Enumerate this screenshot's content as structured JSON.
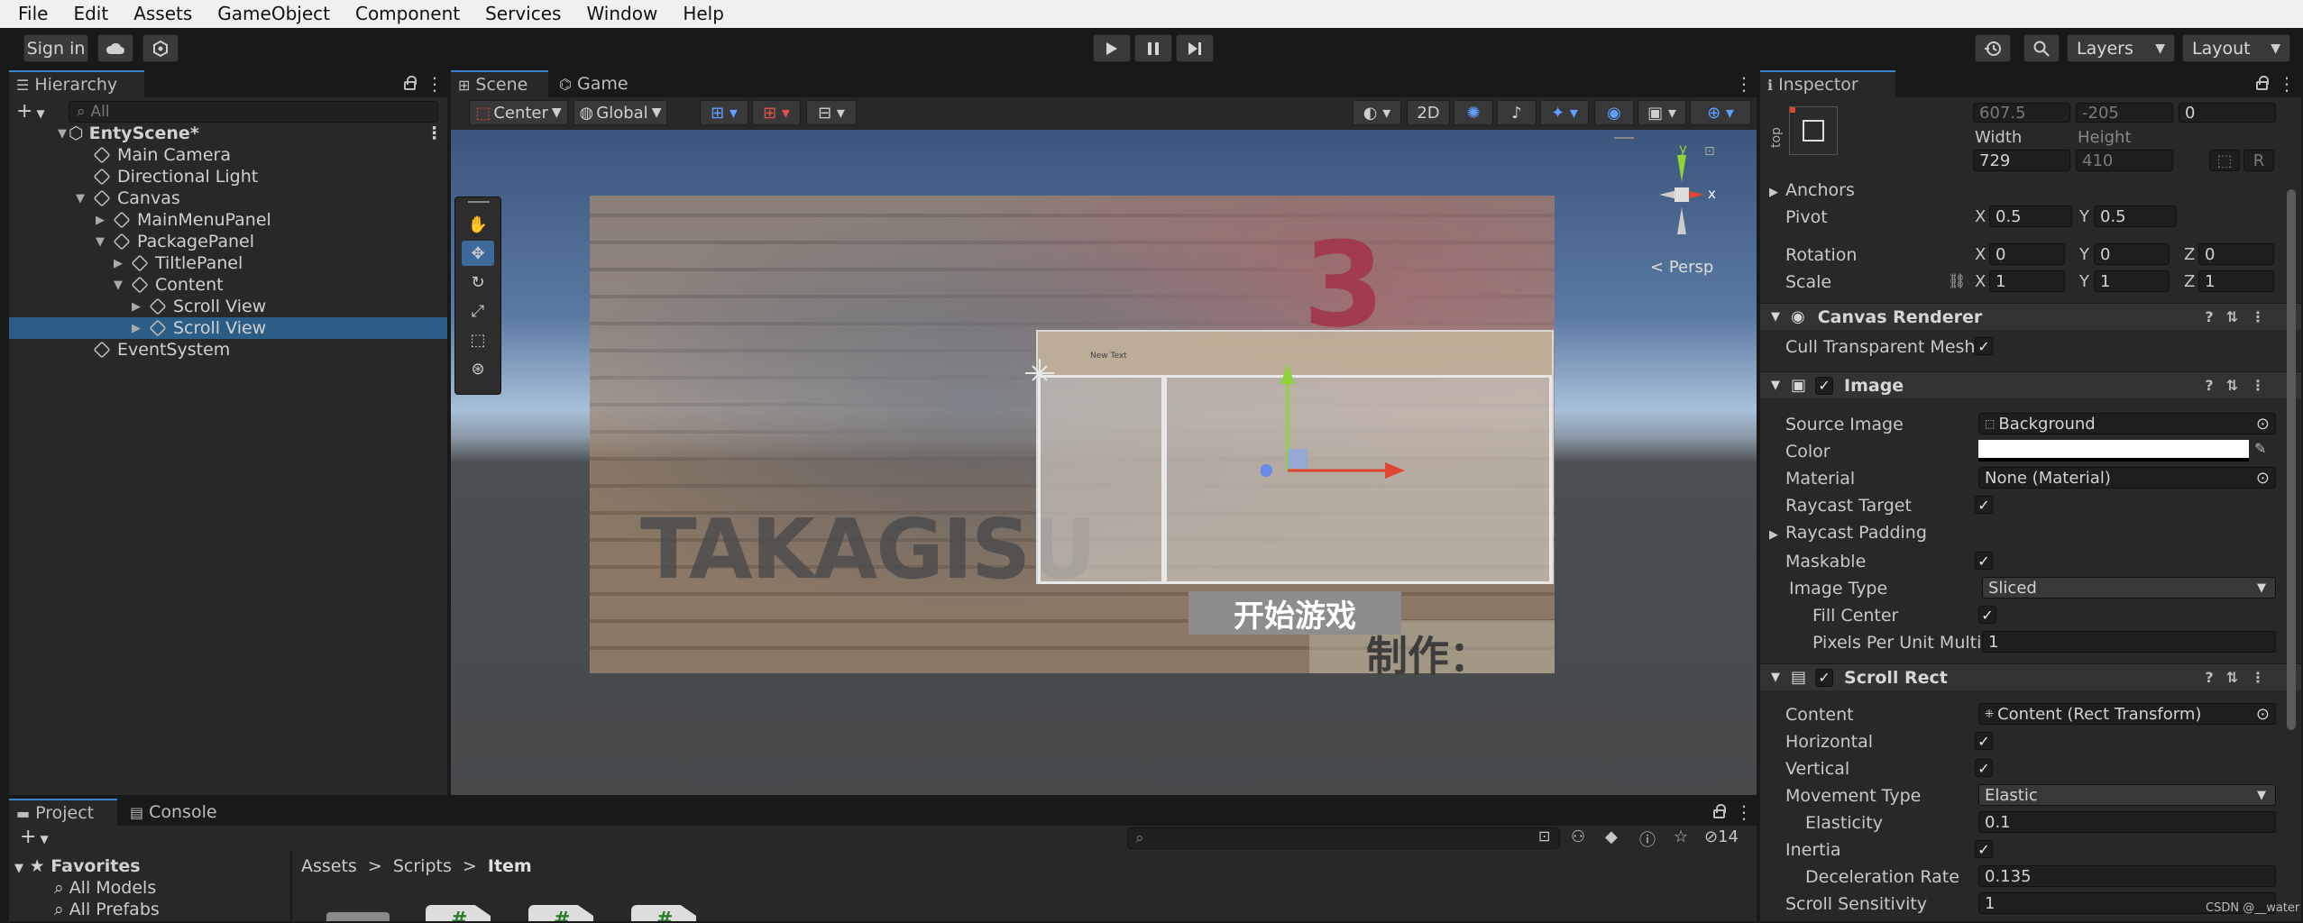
{
  "menu": [
    "File",
    "Edit",
    "Assets",
    "GameObject",
    "Component",
    "Services",
    "Window",
    "Help"
  ],
  "toolbar": {
    "sign_in": "Sign in",
    "layers": "Layers",
    "layout": "Layout"
  },
  "hierarchy": {
    "tab": "Hierarchy",
    "search_placeholder": "All",
    "items": [
      {
        "label": "EntyScene*"
      },
      {
        "label": "Main Camera"
      },
      {
        "label": "Directional Light"
      },
      {
        "label": "Canvas"
      },
      {
        "label": "MainMenuPanel"
      },
      {
        "label": "PackagePanel"
      },
      {
        "label": "TiltlePanel"
      },
      {
        "label": "Content"
      },
      {
        "label": "Scroll View"
      },
      {
        "label": "Scroll View"
      },
      {
        "label": "EventSystem"
      }
    ]
  },
  "scene": {
    "tab_scene": "Scene",
    "tab_game": "Game",
    "pivot": "Center",
    "space": "Global",
    "mode_2d": "2D",
    "persp": "Persp",
    "gizmo_x": "x",
    "gizmo_y": "y",
    "panel_title_text": "New Text",
    "start_button": "开始游戏",
    "maker_text": "制作：",
    "logo_text": "TAKAGISU",
    "big_number": "3"
  },
  "inspector": {
    "tab": "Inspector",
    "rect": {
      "side_label": "top",
      "pos_y": "607.5",
      "pos_y2": "-205",
      "pos_z": "0",
      "width_label": "Width",
      "height_label": "Height",
      "width": "729",
      "height": "410",
      "r_label": "R",
      "anchors": "Anchors",
      "pivot_label": "Pivot",
      "pivot_x": "0.5",
      "pivot_y": "0.5",
      "rotation_label": "Rotation",
      "rot_x": "0",
      "rot_y": "0",
      "rot_z": "0",
      "scale_label": "Scale",
      "scale_x": "1",
      "scale_y": "1",
      "scale_z": "1"
    },
    "canvas_renderer": {
      "title": "Canvas Renderer",
      "cull_label": "Cull Transparent Mesh"
    },
    "image": {
      "title": "Image",
      "source_label": "Source Image",
      "source_value": "Background",
      "color_label": "Color",
      "material_label": "Material",
      "material_value": "None (Material)",
      "raycast_target": "Raycast Target",
      "raycast_padding": "Raycast Padding",
      "maskable": "Maskable",
      "image_type_label": "Image Type",
      "image_type_value": "Sliced",
      "fill_center": "Fill Center",
      "ppu_label": "Pixels Per Unit Multip",
      "ppu_value": "1"
    },
    "scroll_rect": {
      "title": "Scroll Rect",
      "content_label": "Content",
      "content_value": "Content (Rect Transform)",
      "horizontal": "Horizontal",
      "vertical": "Vertical",
      "movement_label": "Movement Type",
      "movement_value": "Elastic",
      "elasticity_label": "Elasticity",
      "elasticity_value": "0.1",
      "inertia": "Inertia",
      "decel_label": "Deceleration Rate",
      "decel_value": "0.135",
      "sensitivity_label": "Scroll Sensitivity",
      "sensitivity_value": "1"
    }
  },
  "project": {
    "tab_project": "Project",
    "tab_console": "Console",
    "favorites": "Favorites",
    "fav_items": [
      "All Models",
      "All Prefabs"
    ],
    "breadcrumb": [
      "Assets",
      "Scripts",
      "Item"
    ],
    "hidden_count": "14"
  },
  "watermark": "CSDN @__water",
  "colors": {
    "accent": "#3d7fd1",
    "selection": "#2c5d87",
    "gizmo_x": "#e0452f",
    "gizmo_y": "#8fd43a"
  }
}
